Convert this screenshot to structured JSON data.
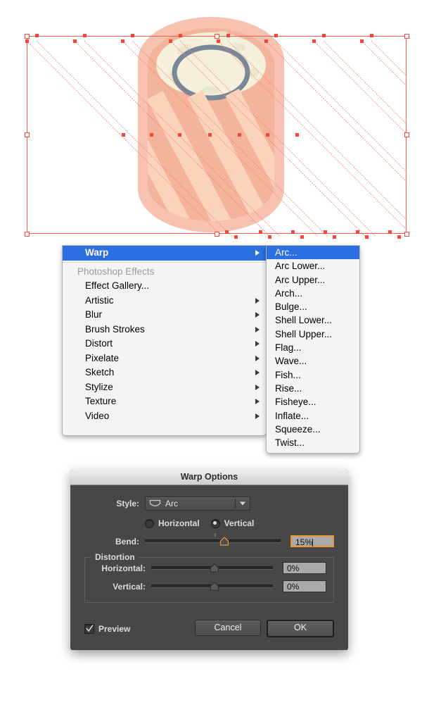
{
  "canvas": {
    "name": "illustrator-artboard",
    "selection": {
      "label": "warp-mesh-selection",
      "color": "#f8463a"
    },
    "artwork": {
      "label": "capsule-artwork",
      "colors": {
        "body": "#f4b39b",
        "stripe": "#fbd3ba",
        "cream": "#f4f0dc",
        "ring": "#7a8799",
        "outer_glow": "#f7c3b0"
      }
    }
  },
  "menu": {
    "name": "effect-context-menu",
    "selected_label": "Warp",
    "section_header": "Photoshop Effects",
    "items": [
      {
        "label": "Effect Gallery...",
        "submenu": false
      },
      {
        "label": "Artistic",
        "submenu": true
      },
      {
        "label": "Blur",
        "submenu": true
      },
      {
        "label": "Brush Strokes",
        "submenu": true
      },
      {
        "label": "Distort",
        "submenu": true
      },
      {
        "label": "Pixelate",
        "submenu": true
      },
      {
        "label": "Sketch",
        "submenu": true
      },
      {
        "label": "Stylize",
        "submenu": true
      },
      {
        "label": "Texture",
        "submenu": true
      },
      {
        "label": "Video",
        "submenu": true
      }
    ],
    "highlight_color": "#2b6fe0"
  },
  "submenu": {
    "name": "warp-style-submenu",
    "items": [
      {
        "label": "Arc...",
        "selected": true
      },
      {
        "label": "Arc Lower...",
        "selected": false
      },
      {
        "label": "Arc Upper...",
        "selected": false
      },
      {
        "label": "Arch...",
        "selected": false
      },
      {
        "label": "Bulge...",
        "selected": false
      },
      {
        "label": "Shell Lower...",
        "selected": false
      },
      {
        "label": "Shell Upper...",
        "selected": false
      },
      {
        "label": "Flag...",
        "selected": false
      },
      {
        "label": "Wave...",
        "selected": false
      },
      {
        "label": "Fish...",
        "selected": false
      },
      {
        "label": "Rise...",
        "selected": false
      },
      {
        "label": "Fisheye...",
        "selected": false
      },
      {
        "label": "Inflate...",
        "selected": false
      },
      {
        "label": "Squeeze...",
        "selected": false
      },
      {
        "label": "Twist...",
        "selected": false
      }
    ]
  },
  "dialog": {
    "title": "Warp Options",
    "style": {
      "label": "Style:",
      "value": "Arc",
      "icon": "warp-arc-icon"
    },
    "orientation": {
      "horizontal_label": "Horizontal",
      "vertical_label": "Vertical",
      "selected": "Vertical"
    },
    "bend": {
      "label": "Bend:",
      "value": "15%",
      "slider_percent": 57,
      "focused": true
    },
    "distortion": {
      "legend": "Distortion",
      "horizontal": {
        "label": "Horizontal:",
        "value": "0%",
        "slider_percent": 50
      },
      "vertical": {
        "label": "Vertical:",
        "value": "0%",
        "slider_percent": 50
      }
    },
    "preview": {
      "label": "Preview",
      "checked": true
    },
    "buttons": {
      "cancel": "Cancel",
      "ok": "OK"
    },
    "accent_color": "#e8982f"
  }
}
